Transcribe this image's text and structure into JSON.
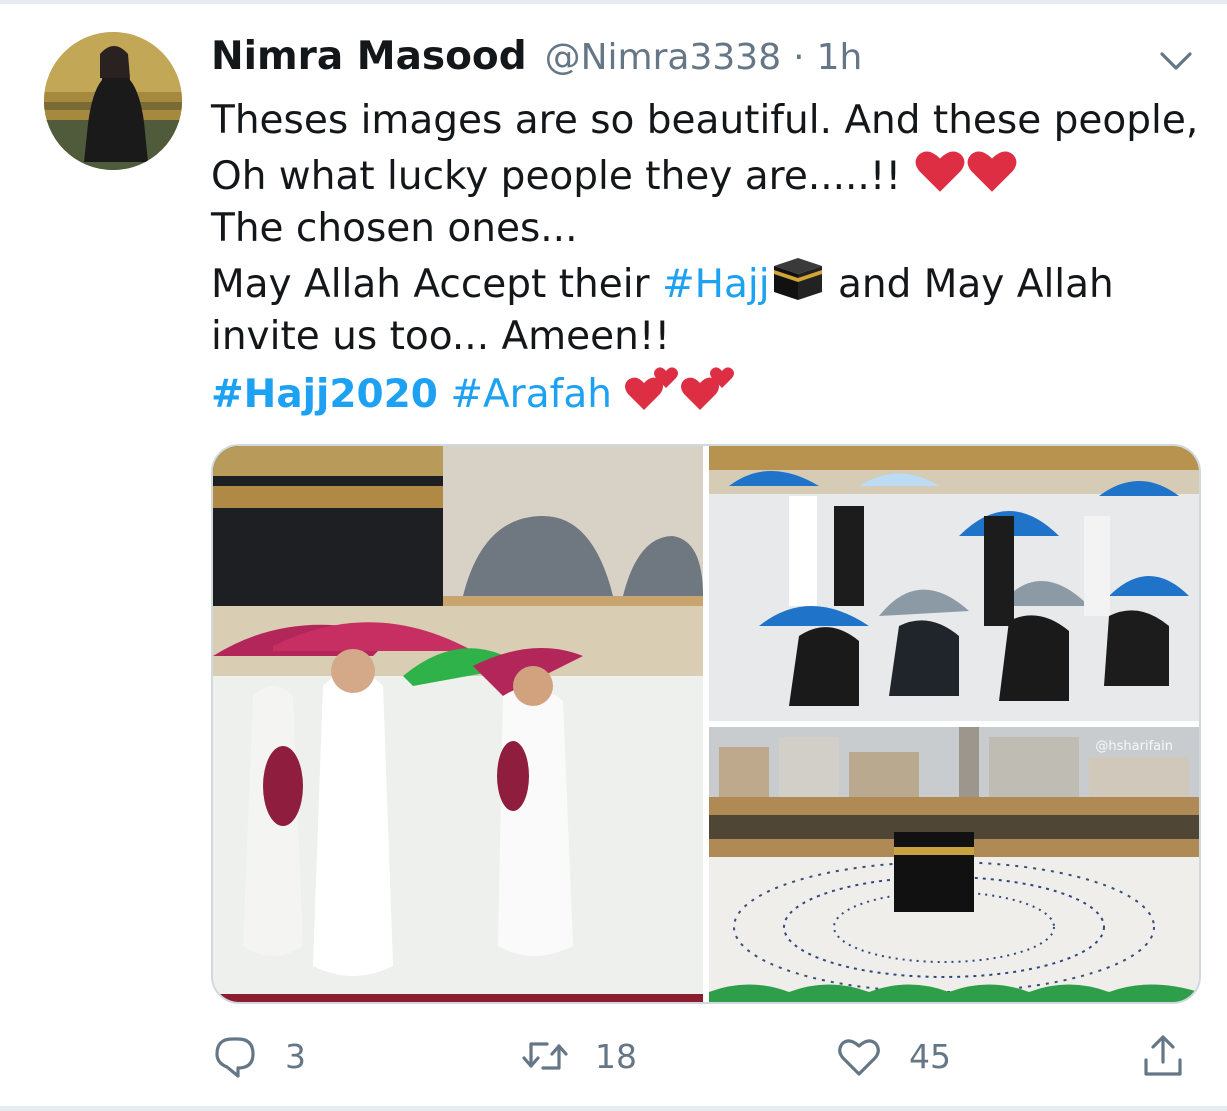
{
  "tweet": {
    "display_name": "Nimra Masood",
    "handle": "@Nimra3338",
    "separator": "·",
    "time": "1h",
    "text_lines": [
      "Theses images are so beautiful. And these people,",
      "Oh what lucky people they are.....!!",
      "The chosen ones...",
      "May Allah Accept their",
      "and May Allah",
      "invite us too... Ameen!!"
    ],
    "hashtags": {
      "hajj": "#Hajj",
      "hajj2020": "#Hajj2020",
      "arafah": "#Arafah"
    },
    "emojis": [
      "red-heart",
      "red-heart",
      "kaaba",
      "two-hearts",
      "two-hearts"
    ],
    "media": {
      "count": 3,
      "watermark": "@hsharifain"
    },
    "stats": {
      "replies": "3",
      "retweets": "18",
      "likes": "45"
    }
  },
  "colors": {
    "link": "#1da1f2",
    "text": "#14171a",
    "secondary": "#657786",
    "divider": "#e6ecf0",
    "heart": "#e0245e"
  },
  "icons": {
    "reply": "speech-bubble-icon",
    "retweet": "retweet-arrows-icon",
    "like": "heart-outline-icon",
    "share": "share-upload-icon",
    "menu": "chevron-down-icon"
  }
}
